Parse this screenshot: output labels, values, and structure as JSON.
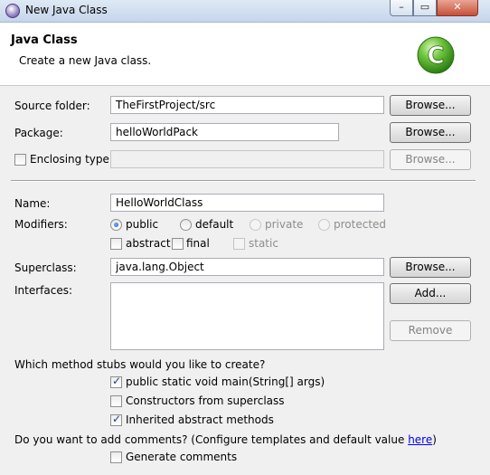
{
  "window": {
    "title": "New Java Class",
    "minimize": "–",
    "maximize": "▭",
    "close": "✕"
  },
  "header": {
    "title": "Java Class",
    "subtitle": "Create a new Java class.",
    "logo": "C"
  },
  "source_folder": {
    "label": "Source folder:",
    "value": "TheFirstProject/src",
    "browse": "Browse..."
  },
  "package": {
    "label": "Package:",
    "value": "helloWorldPack",
    "browse": "Browse..."
  },
  "enclosing_type": {
    "label": "Enclosing type:",
    "value": "",
    "browse": "Browse...",
    "checked": false
  },
  "name": {
    "label": "Name:",
    "value": "HelloWorldClass"
  },
  "modifiers": {
    "label": "Modifiers:",
    "public": "public",
    "default": "default",
    "private": "private",
    "protected": "protected",
    "abstract": "abstract",
    "final": "final",
    "static": "static"
  },
  "superclass": {
    "label": "Superclass:",
    "value": "java.lang.Object",
    "browse": "Browse..."
  },
  "interfaces": {
    "label": "Interfaces:",
    "add": "Add...",
    "remove": "Remove"
  },
  "stubs": {
    "question": "Which method stubs would you like to create?",
    "main": "public static void main(String[] args)",
    "constructors": "Constructors from superclass",
    "inherited": "Inherited abstract methods"
  },
  "comments": {
    "question": "Do you want to add comments? (Configure templates and default value ",
    "link": "here",
    "close_paren": ")",
    "generate": "Generate comments"
  },
  "colors": {
    "accent": "#3a9a1a",
    "link": "#0000ee"
  }
}
